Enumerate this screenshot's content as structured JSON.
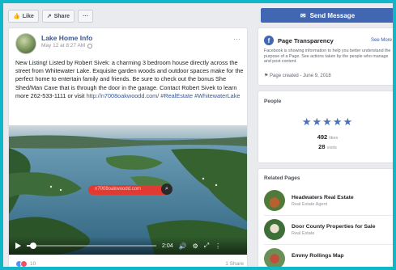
{
  "toolbar": {
    "like_label": "Like",
    "share_label": "Share",
    "more_label": "···"
  },
  "post": {
    "page_name": "Lake Home Info",
    "date": "May 12 at 8:27 AM",
    "text_main": "New Listing! Listed by Robert Sivek: a charming 3 bedroom house directly across the street from Whitewater Lake. Exquisite garden woods and outdoor spaces make for the perfect home to entertain family and friends. Be sure to check out the bonus She Shed/Man Cave that is through the door in the garage. Contact Robert Sivek to learn more 262-533-1111 or visit ",
    "text_link": "http://n7008oakwoodd.com/",
    "text_tags": " #RealEstate #WhitewaterLake",
    "video": {
      "url_overlay": "n7008oakwoodd.com",
      "time_remaining": "2:04",
      "progress": 0.05
    },
    "reactions_count": "10",
    "shares": "1 Share"
  },
  "sidebar": {
    "send_message_label": "Send Message",
    "transparency": {
      "title": "Page Transparency",
      "see_more": "See More",
      "description": "Facebook is showing information to help you better understand the purpose of a Page. See actions taken by the people who manage and post content.",
      "created": "Page created - June 9, 2018"
    },
    "people": {
      "title": "People",
      "rating_stars": "★★★★★",
      "likes_value": "492",
      "likes_label": "likes",
      "visits_value": "28",
      "visits_label": "visits"
    },
    "related": {
      "title": "Related Pages",
      "items": [
        {
          "name": "Headwaters Real Estate",
          "category": "Real Estate Agent"
        },
        {
          "name": "Door County Properties for Sale",
          "category": "Real Estate"
        },
        {
          "name": "Emmy Rollings Map",
          "category": ""
        }
      ]
    }
  },
  "colors": {
    "brand": "#4267b2",
    "link": "#365899",
    "frame": "#10b7c9",
    "overlay_red": "#e03a32"
  }
}
